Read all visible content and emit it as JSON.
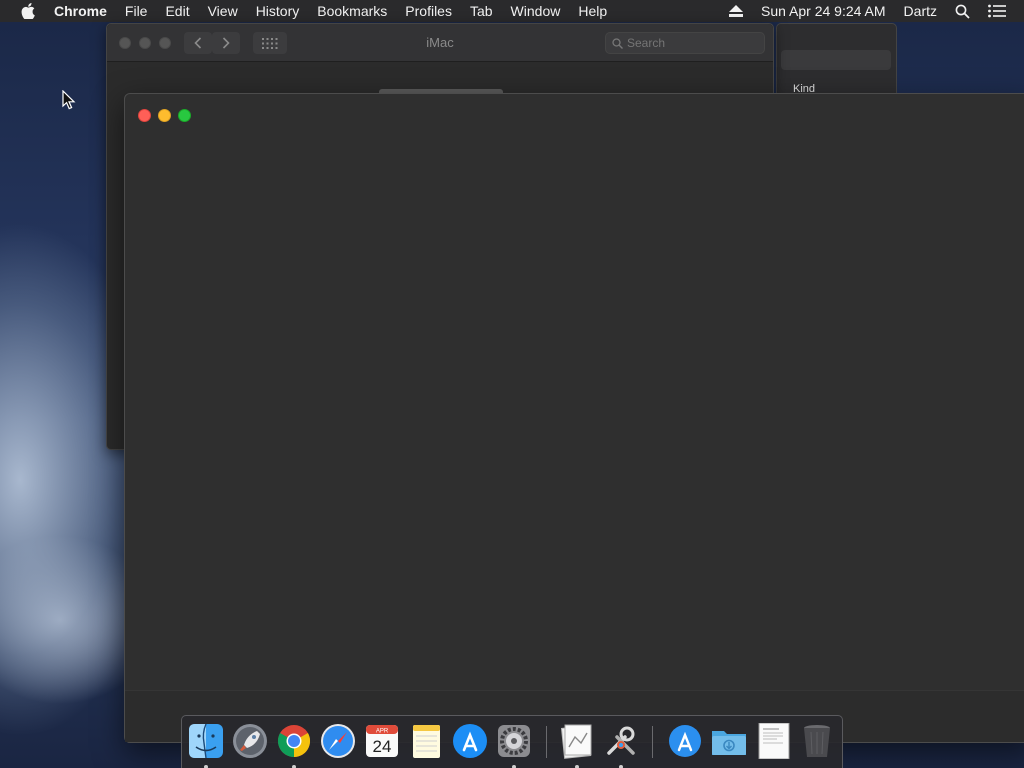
{
  "menubar": {
    "apple_icon": "apple-logo-icon",
    "app_name": "Chrome",
    "items": [
      "File",
      "Edit",
      "View",
      "History",
      "Bookmarks",
      "Profiles",
      "Tab",
      "Window",
      "Help"
    ],
    "datetime": "Sun Apr 24  9:24 AM",
    "user": "Dartz",
    "icons": [
      "eject-icon",
      "spotlight-search-icon",
      "notification-center-icon"
    ]
  },
  "finder_window": {
    "title": "iMac",
    "search_placeholder": "Search"
  },
  "info_window": {
    "kind_label": "Kind"
  },
  "main_window": {
    "traffic_lights": {
      "close": "#ff5f57",
      "minimize": "#febc2e",
      "zoom": "#28c840"
    }
  },
  "dock": {
    "items": [
      {
        "name": "finder-icon",
        "running": true
      },
      {
        "name": "launchpad-icon",
        "running": false
      },
      {
        "name": "chrome-icon",
        "running": true
      },
      {
        "name": "safari-icon",
        "running": false
      },
      {
        "name": "calendar-icon",
        "running": false,
        "month": "APR",
        "day": "24"
      },
      {
        "name": "notes-icon",
        "running": false
      },
      {
        "name": "app-store-icon",
        "running": false
      },
      {
        "name": "system-preferences-icon",
        "running": true
      },
      {
        "name": "preview-icon",
        "running": true
      },
      {
        "name": "utilities-icon",
        "running": true
      },
      {
        "name": "applications-folder-icon",
        "running": false
      },
      {
        "name": "downloads-folder-icon",
        "running": false
      },
      {
        "name": "document-stack-icon",
        "running": false
      },
      {
        "name": "trash-icon",
        "running": false
      }
    ]
  }
}
